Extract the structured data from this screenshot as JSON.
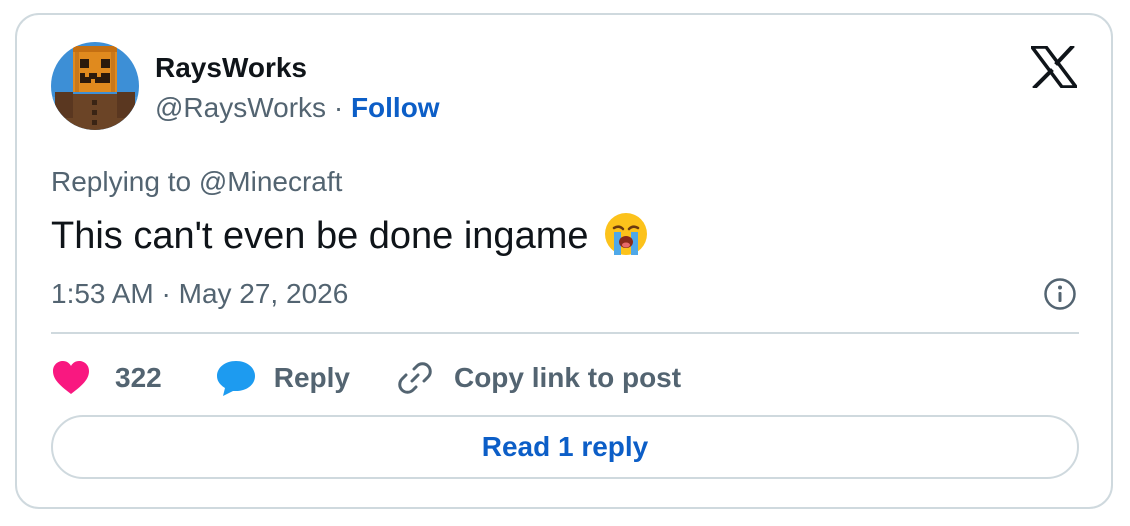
{
  "author": {
    "display_name": "RaysWorks",
    "handle": "@RaysWorks",
    "separator": "·",
    "follow_label": "Follow",
    "avatar_icon": "pumpkin-head-character-avatar"
  },
  "platform_logo": "x-logo",
  "replying_to": "Replying to @Minecraft",
  "post_text": "This can't even be done ingame",
  "emoji": "loudly-crying-face",
  "timestamp": "1:53 AM · May 27, 2026",
  "actions": {
    "like_count": "322",
    "reply_label": "Reply",
    "copy_link_label": "Copy link to post"
  },
  "read_replies_label": "Read 1 reply",
  "colors": {
    "accent_blue": "#0c5ec7",
    "heart": "#f91880",
    "reply_bubble": "#1d9bf0",
    "muted_text": "#536471",
    "border": "#cfd9de"
  }
}
